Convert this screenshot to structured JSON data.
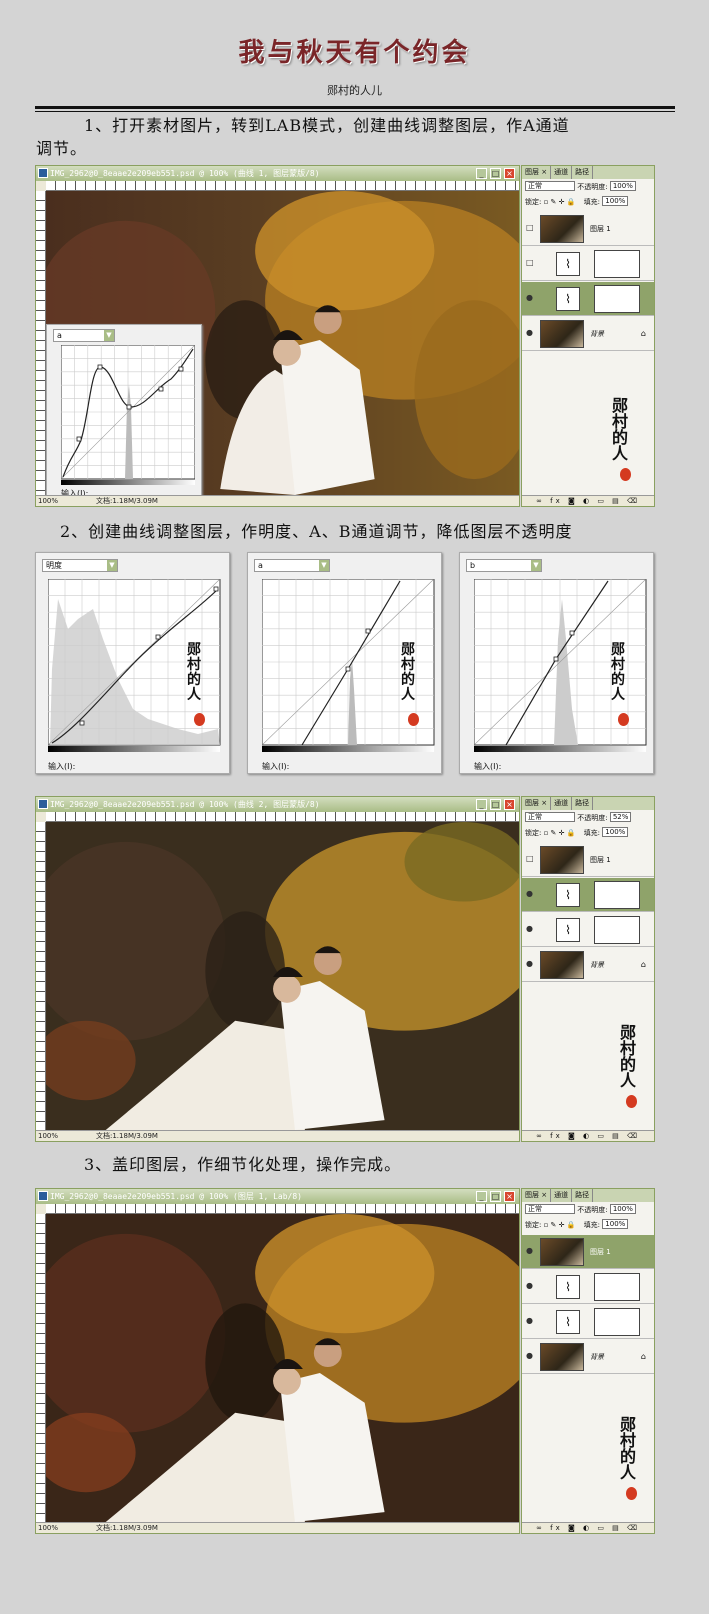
{
  "header": {
    "title": "我与秋天有个约会",
    "author": "郧村的人儿"
  },
  "steps": {
    "step1_line1": "1、打开素材图片，转到LAB模式，创建曲线调整图层，作A通道",
    "step1_line2": "调节。",
    "step2": "2、创建曲线调整图层，作明度、A、B通道调节，降低图层不透明度",
    "step3": "3、盖印图层，作细节化处理，操作完成。"
  },
  "windows": {
    "win1_title": "IMG_2962@0_8eaae2e209eb551.psd @ 100% (曲线 1, 图层蒙版/8)",
    "win2_title": "IMG_2962@0_8eaae2e209eb551.psd @ 100% (曲线 2, 图层蒙版/8)",
    "win3_title": "IMG_2962@0_8eaae2e209eb551.psd @ 100% (图层 1, Lab/8)",
    "zoom": "100%",
    "doc_size": "文档:1.18M/3.09M"
  },
  "panel": {
    "tabs": [
      "图层 ×",
      "通道",
      "路径"
    ],
    "blend_mode": "正常",
    "opacity_label": "不透明度:",
    "opacity_values": [
      "100%",
      "52%",
      "100%"
    ],
    "lock_label": "锁定:",
    "fill_label": "填充:",
    "fill_value": "100%",
    "layer1_name": "图层 1",
    "background_name": "背景",
    "footer_icons": "∞ fx ◙ ◐ ▭ ▤ ⌫"
  },
  "calligraphy": {
    "text": "郧村的人儿"
  },
  "curves": {
    "win1_channel": "a",
    "channels": [
      "明度",
      "a",
      "b"
    ],
    "input_label": "输入(I):"
  },
  "colors": {
    "title": "#7a2528",
    "accent_green": "#8fa36a",
    "seal_red": "#d43a20"
  }
}
